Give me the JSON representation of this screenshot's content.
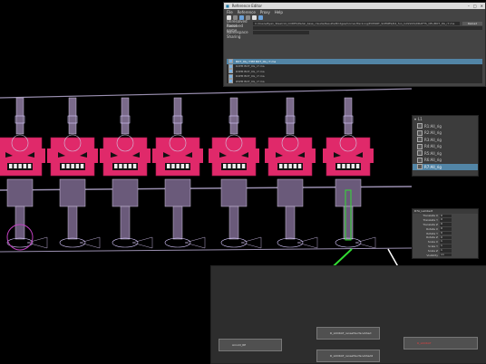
{
  "reference_editor": {
    "title": "Reference Editor",
    "menus": [
      "File",
      "Reference",
      "Proxy",
      "Help"
    ],
    "fields": [
      {
        "label": "Unresolved name",
        "value": "C:/Users/Ryan_Steel/1d_CODES/Pedal_base_claude/Results/Bridges/Corner/Pack.ing/EXPORT_SCENES/R4_fun_CASSIUS/DRAFTS_CEL/BOT_0G_r7.ma"
      },
      {
        "label": "Resolved name",
        "value": ""
      },
      {
        "label": "Namespace",
        "value": ""
      },
      {
        "label": "Sharing",
        "value": ""
      }
    ],
    "reload_label": "Reload",
    "list": [
      {
        "name": "BOT_0G_r7PM BOT_0G_r7.ma",
        "selected": true
      },
      {
        "name": "R2PM BOT_0G_r7.ma",
        "selected": false
      },
      {
        "name": "R3PM BOT_0G_r7.ma",
        "selected": false
      },
      {
        "name": "R4PM BOT_0G_r7.ma",
        "selected": false
      },
      {
        "name": "R5PM BOT_0G_r7.ma",
        "selected": false
      }
    ]
  },
  "outliner": {
    "root": "L1",
    "items": [
      {
        "label": "R1:All_rig",
        "selected": false
      },
      {
        "label": "R2:All_rig",
        "selected": false
      },
      {
        "label": "R3:All_rig",
        "selected": false
      },
      {
        "label": "R4:All_rig",
        "selected": false
      },
      {
        "label": "R5:All_rig",
        "selected": false
      },
      {
        "label": "R6:All_rig",
        "selected": false
      },
      {
        "label": "R7:All_rig",
        "selected": true
      }
    ]
  },
  "channel_box": {
    "title": "R7A_Lambert",
    "attributes": [
      {
        "label": "Translate X",
        "value": "0"
      },
      {
        "label": "Translate Y",
        "value": "0"
      },
      {
        "label": "Translate Z",
        "value": "0"
      },
      {
        "label": "Rotate X",
        "value": "0"
      },
      {
        "label": "Rotate Y",
        "value": "0"
      },
      {
        "label": "Rotate Z",
        "value": "0"
      },
      {
        "label": "Scale X",
        "value": "1"
      },
      {
        "label": "Scale Y",
        "value": "1"
      },
      {
        "label": "Scale Z",
        "value": "1"
      },
      {
        "label": "Visibility",
        "value": "on"
      }
    ]
  },
  "node_editor": {
    "nodes": [
      {
        "id": "n1",
        "label": "Arnold_RE"
      },
      {
        "id": "n2",
        "label": "R_LOOKAT_rensetSurfaceShad"
      },
      {
        "id": "n3",
        "label": "R_LOOKAT_rensetSurfaceShad2"
      },
      {
        "id": "n4",
        "label": "R_LOOKAT"
      }
    ]
  },
  "colors": {
    "accent": "#5285a6",
    "robot_pink": "#e0296a",
    "green_wire": "#33dd33",
    "white_wire": "#ffffff"
  }
}
